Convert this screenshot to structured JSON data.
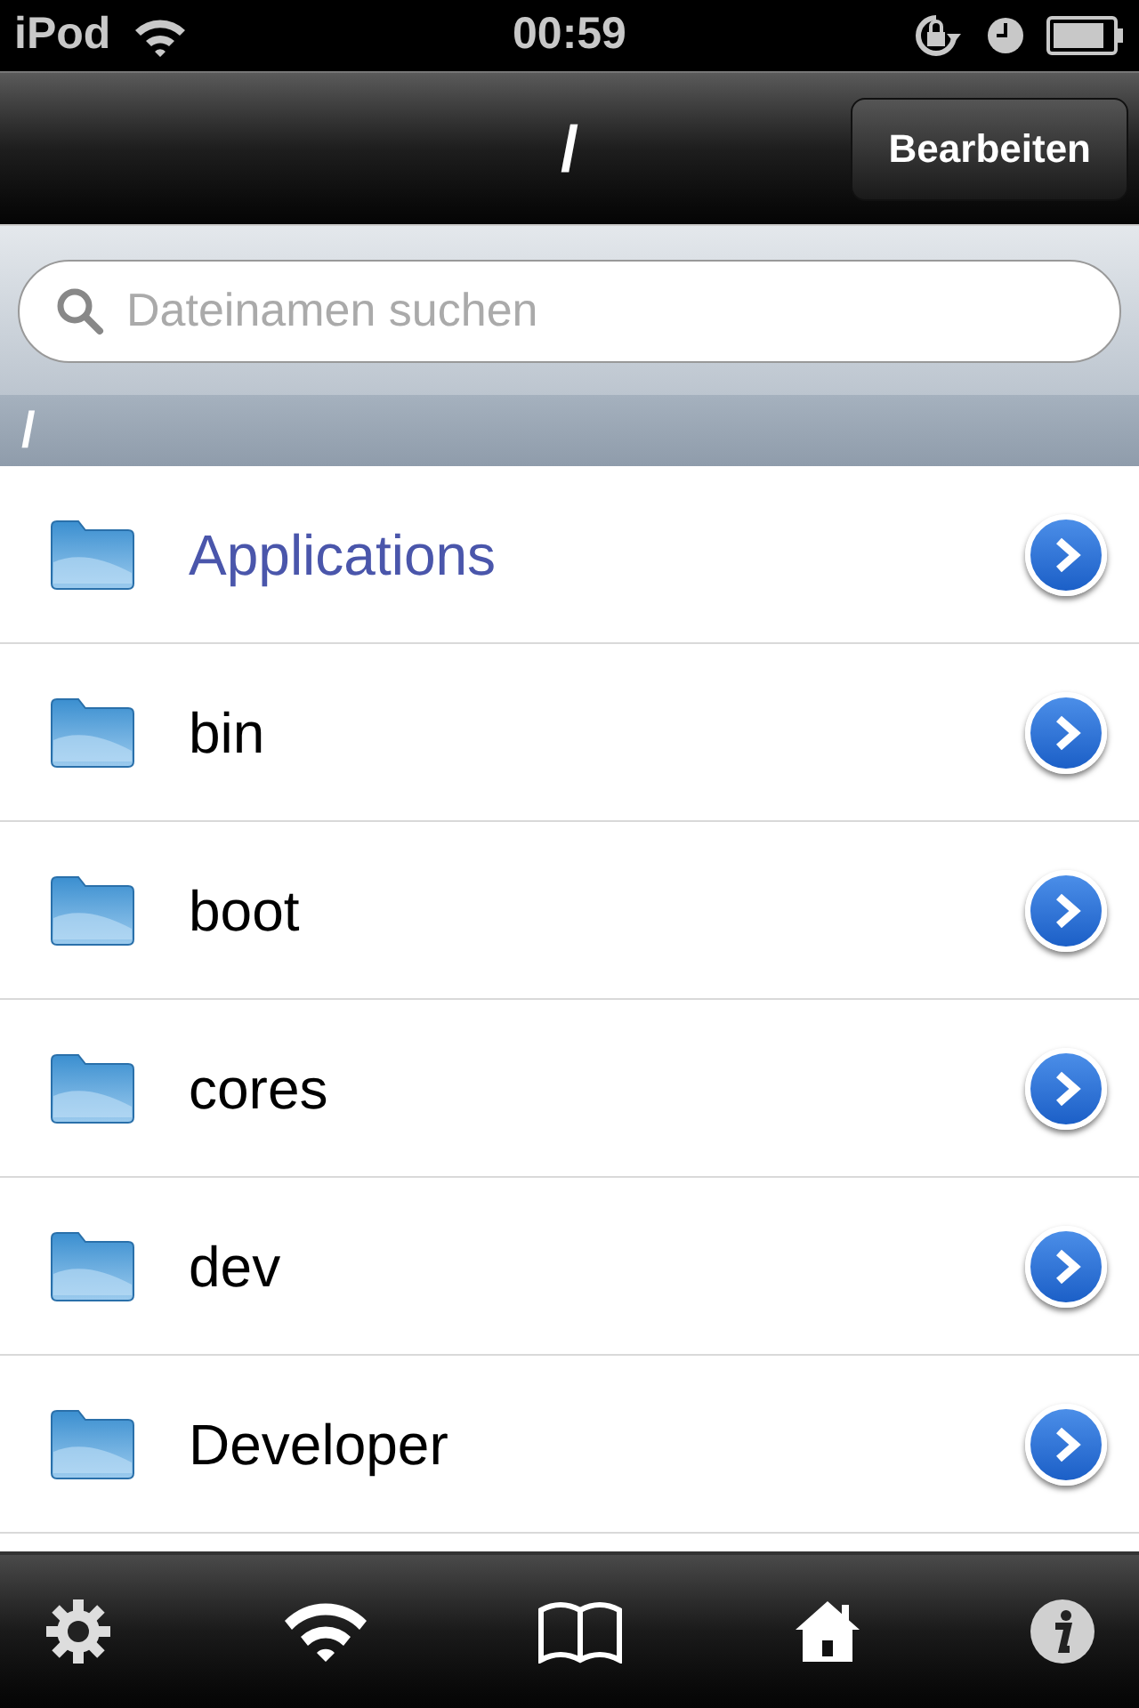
{
  "status_bar": {
    "carrier": "iPod",
    "time": "00:59"
  },
  "nav_bar": {
    "title": "/",
    "edit_button": "Bearbeiten"
  },
  "search": {
    "placeholder": "Dateinamen suchen"
  },
  "section_header": "/",
  "files": [
    {
      "name": "Applications",
      "kind": "link"
    },
    {
      "name": "bin",
      "kind": "folder"
    },
    {
      "name": "boot",
      "kind": "folder"
    },
    {
      "name": "cores",
      "kind": "folder"
    },
    {
      "name": "dev",
      "kind": "folder"
    },
    {
      "name": "Developer",
      "kind": "folder"
    }
  ],
  "tab_bar": [
    {
      "kind": "settings"
    },
    {
      "kind": "wifi"
    },
    {
      "kind": "book"
    },
    {
      "kind": "home"
    },
    {
      "kind": "info"
    }
  ]
}
